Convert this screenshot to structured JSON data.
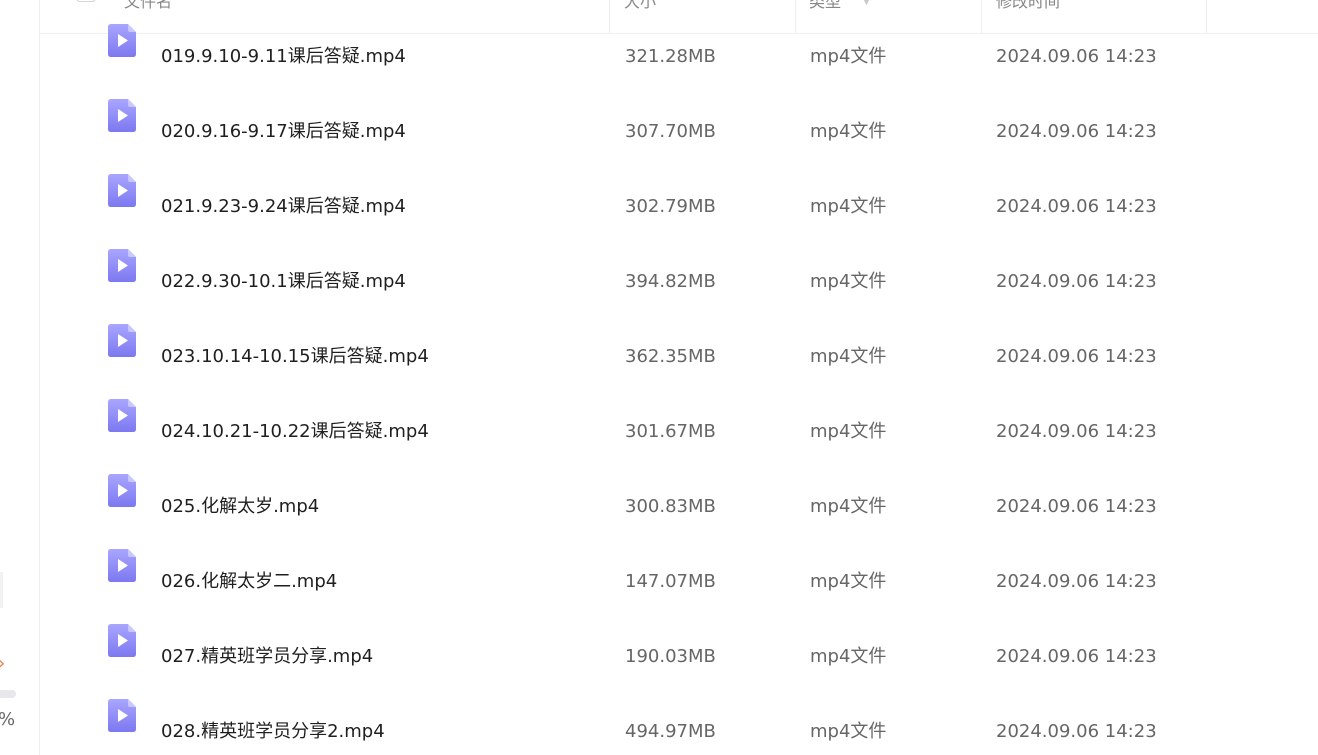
{
  "sidebar": {
    "arrow_glyph": "›",
    "percent_text": "%"
  },
  "table": {
    "headers": {
      "name": "文件名",
      "size": "大小",
      "type": "类型",
      "modified": "修改时间"
    },
    "rows": [
      {
        "name": "019.9.10-9.11课后答疑.mp4",
        "size": "321.28MB",
        "type": "mp4文件",
        "modified": "2024.09.06 14:23"
      },
      {
        "name": "020.9.16-9.17课后答疑.mp4",
        "size": "307.70MB",
        "type": "mp4文件",
        "modified": "2024.09.06 14:23"
      },
      {
        "name": "021.9.23-9.24课后答疑.mp4",
        "size": "302.79MB",
        "type": "mp4文件",
        "modified": "2024.09.06 14:23"
      },
      {
        "name": "022.9.30-10.1课后答疑.mp4",
        "size": "394.82MB",
        "type": "mp4文件",
        "modified": "2024.09.06 14:23"
      },
      {
        "name": "023.10.14-10.15课后答疑.mp4",
        "size": "362.35MB",
        "type": "mp4文件",
        "modified": "2024.09.06 14:23"
      },
      {
        "name": "024.10.21-10.22课后答疑.mp4",
        "size": "301.67MB",
        "type": "mp4文件",
        "modified": "2024.09.06 14:23"
      },
      {
        "name": "025.化解太岁.mp4",
        "size": "300.83MB",
        "type": "mp4文件",
        "modified": "2024.09.06 14:23"
      },
      {
        "name": "026.化解太岁二.mp4",
        "size": "147.07MB",
        "type": "mp4文件",
        "modified": "2024.09.06 14:23"
      },
      {
        "name": "027.精英班学员分享.mp4",
        "size": "190.03MB",
        "type": "mp4文件",
        "modified": "2024.09.06 14:23"
      },
      {
        "name": "028.精英班学员分享2.mp4",
        "size": "494.97MB",
        "type": "mp4文件",
        "modified": "2024.09.06 14:23"
      }
    ]
  },
  "icons": {
    "file": "video-file-icon",
    "sort": "sort-arrow-icon"
  },
  "colors": {
    "icon_gradient_top": "#a9a6ff",
    "icon_gradient_bottom": "#7c78f0",
    "text_primary": "#1f1f1f",
    "text_secondary": "#666666",
    "accent_orange": "#f07b3f"
  }
}
